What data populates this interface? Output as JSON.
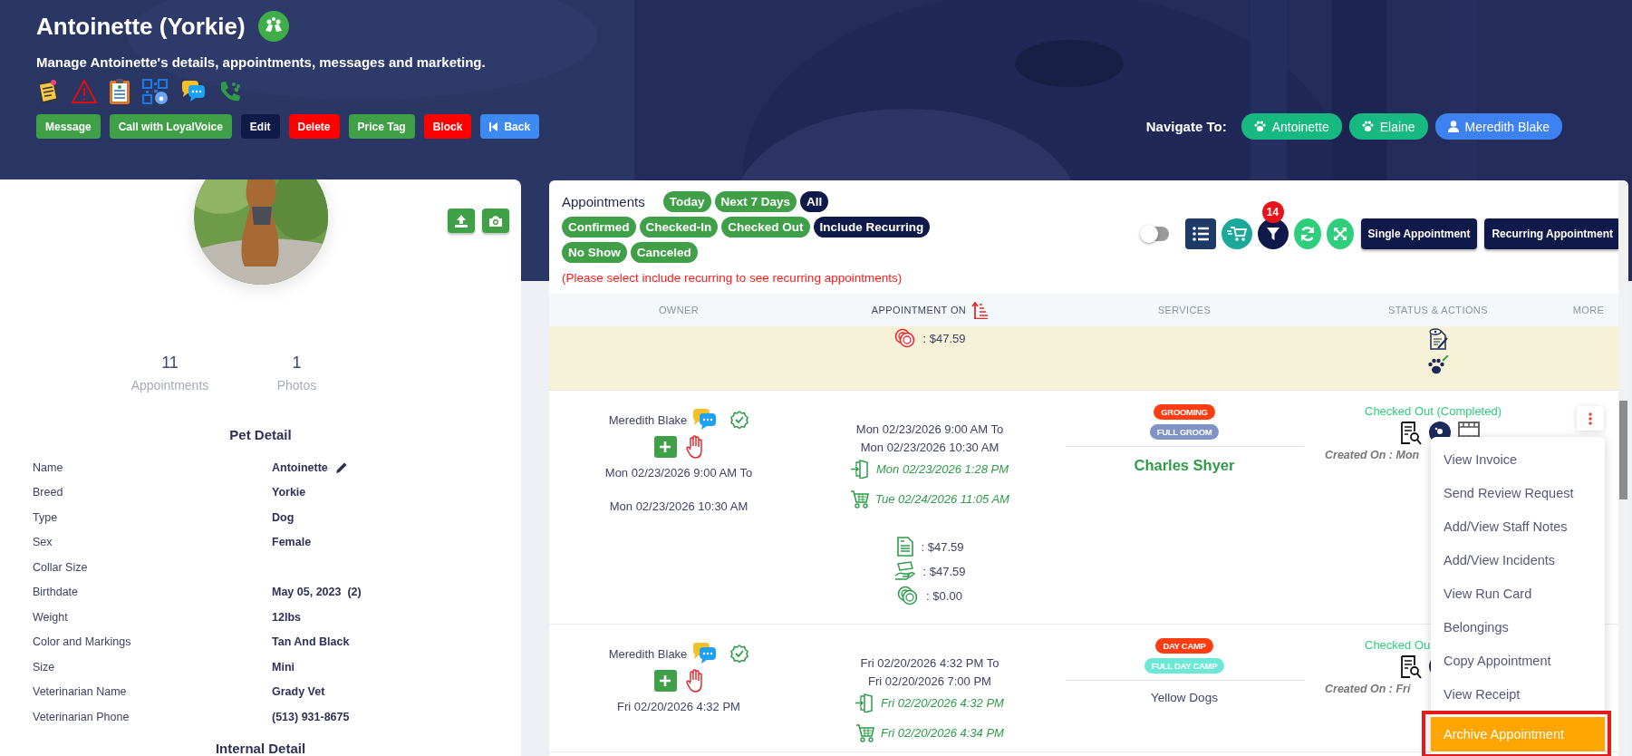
{
  "header": {
    "title": "Antoinette (Yorkie)",
    "subtitle": "Manage Antoinette's details, appointments, messages and marketing.",
    "buttons": [
      {
        "label": "Message",
        "kind": "success"
      },
      {
        "label": "Call with LoyalVoice",
        "kind": "success"
      },
      {
        "label": "Edit",
        "kind": "dark"
      },
      {
        "label": "Delete",
        "kind": "danger"
      },
      {
        "label": "Price Tag",
        "kind": "success"
      },
      {
        "label": "Block",
        "kind": "danger"
      },
      {
        "label": "Back",
        "kind": "back"
      }
    ],
    "navigate_label": "Navigate To:",
    "navigate": [
      {
        "label": "Antoinette",
        "kind": "pet"
      },
      {
        "label": "Elaine",
        "kind": "pet"
      },
      {
        "label": "Meredith Blake",
        "kind": "person"
      }
    ]
  },
  "profile": {
    "stats": [
      {
        "value": "11",
        "label": "Appointments"
      },
      {
        "value": "1",
        "label": "Photos"
      }
    ],
    "pet_detail_title": "Pet Detail",
    "details": [
      {
        "label": "Name",
        "value": "Antoinette",
        "editable": true
      },
      {
        "label": "Breed",
        "value": "Yorkie",
        "editable": false
      },
      {
        "label": "Type",
        "value": "Dog",
        "editable": false
      },
      {
        "label": "Sex",
        "value": "Female",
        "editable": false
      },
      {
        "label": "Collar Size",
        "editable": false
      },
      {
        "label": "Birthdate",
        "value": "May 05, 2023  (2)",
        "editable": false
      },
      {
        "label": "Weight",
        "value": "12lbs",
        "editable": false
      },
      {
        "label": "Color and Markings",
        "value": "Tan And Black",
        "editable": false
      },
      {
        "label": "Size",
        "value": "Mini",
        "editable": false
      },
      {
        "label": "Veterinarian Name",
        "value": "Grady Vet",
        "editable": false
      },
      {
        "label": "Veterinarian Phone",
        "value": "(513) 931-8675",
        "editable": false
      }
    ],
    "internal_detail_title": "Internal Detail"
  },
  "appointments": {
    "title": "Appointments",
    "filter_rows": [
      [
        {
          "label": "Today",
          "selected": false
        },
        {
          "label": "Next 7 Days",
          "selected": false
        },
        {
          "label": "All",
          "selected": true
        }
      ],
      [
        {
          "label": "Confirmed",
          "selected": false
        },
        {
          "label": "Checked-In",
          "selected": false
        },
        {
          "label": "Checked Out",
          "selected": false
        },
        {
          "label": "Include Recurring",
          "selected": true
        }
      ],
      [
        {
          "label": "No Show",
          "selected": false
        },
        {
          "label": "Canceled",
          "selected": false
        }
      ]
    ],
    "note": "(Please select include recurring to see recurring appointments)",
    "toggle": {
      "on": false
    },
    "filter_count": "14",
    "actions": [
      "Single Appointment",
      "Recurring Appointment"
    ],
    "columns": [
      "OWNER",
      "APPOINTMENT ON",
      "SERVICES",
      "STATUS & ACTIONS",
      "MORE"
    ],
    "rows": [
      {
        "highlighted": true,
        "amounts": [
          {
            "kind": "balance",
            "text": ": $47.59"
          }
        ]
      },
      {
        "highlighted": false,
        "owner": {
          "name": "Meredith Blake",
          "dates": [
            "Mon 02/23/2026 9:00 AM To",
            "Mon 02/23/2026 10:30 AM"
          ]
        },
        "schedule": [
          "Mon 02/23/2026 9:00 AM To",
          "Mon 02/23/2026 10:30 AM"
        ],
        "check_in": "Mon 02/23/2026 1:28 PM",
        "check_out": "Tue 02/24/2026 11:05 AM",
        "amounts": [
          {
            "kind": "invoice",
            "text": ": $47.59"
          },
          {
            "kind": "paid",
            "text": ": $47.59"
          },
          {
            "kind": "balance",
            "text": ": $0.00"
          }
        ],
        "tags": [
          {
            "label": "GROOMING",
            "color": "#ff3d12"
          },
          {
            "label": "FULL GROOM",
            "color": "#8093c6"
          }
        ],
        "staff": {
          "name": "Charles Shyer",
          "emphasis": true
        },
        "status": "Checked Out (Completed)",
        "created": "Created On : Mon"
      },
      {
        "highlighted": false,
        "owner": {
          "name": "Meredith Blake",
          "dates": [
            "Fri 02/20/2026 4:32 PM"
          ]
        },
        "schedule": [
          "Fri 02/20/2026 4:32 PM To",
          "Fri 02/20/2026 7:00 PM"
        ],
        "check_in": "Fri 02/20/2026 4:32 PM",
        "check_out": "Fri 02/20/2026 4:34 PM",
        "tags": [
          {
            "label": "DAY CAMP",
            "color": "#ff3d12"
          },
          {
            "label": "FULL DAY CAMP",
            "color": "#6ee8d6"
          }
        ],
        "staff": {
          "name": "Yellow Dogs",
          "emphasis": false
        },
        "status": "Checked Ou",
        "created": "Created On : Fri"
      }
    ],
    "menu": [
      {
        "label": "View Invoice",
        "selected": false
      },
      {
        "label": "Send Review Request",
        "selected": false
      },
      {
        "label": "Add/View Staff Notes",
        "selected": false
      },
      {
        "label": "Add/View Incidents",
        "selected": false
      },
      {
        "label": "View Run Card",
        "selected": false
      },
      {
        "label": "Belongings",
        "selected": false
      },
      {
        "label": "Copy Appointment",
        "selected": false
      },
      {
        "label": "View Receipt",
        "selected": false
      },
      {
        "label": "Archive Appointment",
        "selected": true
      }
    ]
  }
}
